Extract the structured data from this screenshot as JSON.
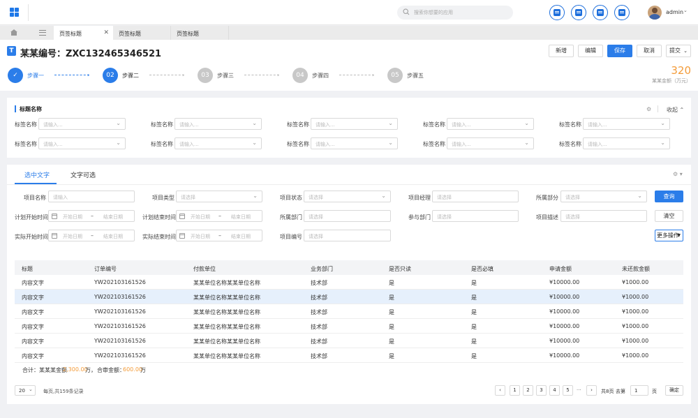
{
  "topbar": {
    "search_placeholder": "搜索你想要的应用",
    "user": "admin",
    "icons": [
      "chat-icon",
      "document-icon",
      "inbox-icon",
      "window-icon"
    ]
  },
  "tabs": [
    "页签标题",
    "页签标题",
    "页签标题"
  ],
  "header": {
    "title": "某某编号：ZXC132465346521",
    "buttons": [
      "新增",
      "编辑",
      "保存",
      "取消",
      "提交"
    ]
  },
  "steps": [
    {
      "num": "",
      "label": "步骤一",
      "done": true
    },
    {
      "num": "02",
      "label": "步骤二",
      "active": true
    },
    {
      "num": "03",
      "label": "步骤三"
    },
    {
      "num": "04",
      "label": "步骤四"
    },
    {
      "num": "05",
      "label": "步骤五"
    }
  ],
  "amount": {
    "value": "320",
    "label": "某某金额（万元）"
  },
  "section1": {
    "title": "标题名称",
    "collapse": "收起",
    "field_label": "标签名称",
    "placeholder": "请输入..."
  },
  "filter": {
    "tabs": [
      "选中文字",
      "文字可选"
    ],
    "labels": {
      "project_name": "项目名称",
      "project_type": "项目类型",
      "project_status": "项目状态",
      "project_manager": "项目经理",
      "dept": "所属部分",
      "plan_start": "计划开始时间",
      "plan_end": "计划结束时间",
      "own_dept": "所属部门",
      "join_dept": "参与部门",
      "project_desc": "项目描述",
      "actual_start": "实际开始时间",
      "actual_end": "实际结束时间",
      "project_no": "项目编号"
    },
    "ph_input": "请输入",
    "ph_select": "请选择",
    "start_date": "开始日期",
    "end_date": "结束日期",
    "query": "查询",
    "clear": "清空",
    "more": "更多操作"
  },
  "table": {
    "columns": [
      "标题",
      "订单编号",
      "付款单位",
      "业务部门",
      "是否只读",
      "是否必填",
      "申请金额",
      "未还款金额"
    ],
    "rows": [
      [
        "内容文字",
        "YW202103161526",
        "某某单位名称某某单位名称",
        "技术部",
        "是",
        "是",
        "¥10000.00",
        "¥1000.00"
      ],
      [
        "内容文字",
        "YW202103161526",
        "某某单位名称某某单位名称",
        "技术部",
        "是",
        "是",
        "¥10000.00",
        "¥1000.00"
      ],
      [
        "内容文字",
        "YW202103161526",
        "某某单位名称某某单位名称",
        "技术部",
        "是",
        "是",
        "¥10000.00",
        "¥1000.00"
      ],
      [
        "内容文字",
        "YW202103161526",
        "某某单位名称某某单位名称",
        "技术部",
        "是",
        "是",
        "¥10000.00",
        "¥1000.00"
      ],
      [
        "内容文字",
        "YW202103161526",
        "某某单位名称某某单位名称",
        "技术部",
        "是",
        "是",
        "¥10000.00",
        "¥1000.00"
      ],
      [
        "内容文字",
        "YW202103161526",
        "某某单位名称某某单位名称",
        "技术部",
        "是",
        "是",
        "¥10000.00",
        "¥1000.00"
      ]
    ],
    "highlight_row": 1,
    "summary": {
      "label1": "合计：某某某金额",
      "value1": "2,300.00",
      "unit1": "万，",
      "label2": "合审金额：",
      "value2": "600.00",
      "unit2": "万"
    }
  },
  "pagination": {
    "page_size": "20",
    "info": "每页,共159条记录",
    "pages": [
      "1",
      "2",
      "3",
      "4",
      "5"
    ],
    "ellipsis": "···",
    "total_pages": "共8页",
    "goto": "去第",
    "goto_value": "1",
    "page_unit": "页",
    "confirm": "确定"
  },
  "colors": {
    "primary": "#2b7de9",
    "accent": "#f39c3a"
  }
}
